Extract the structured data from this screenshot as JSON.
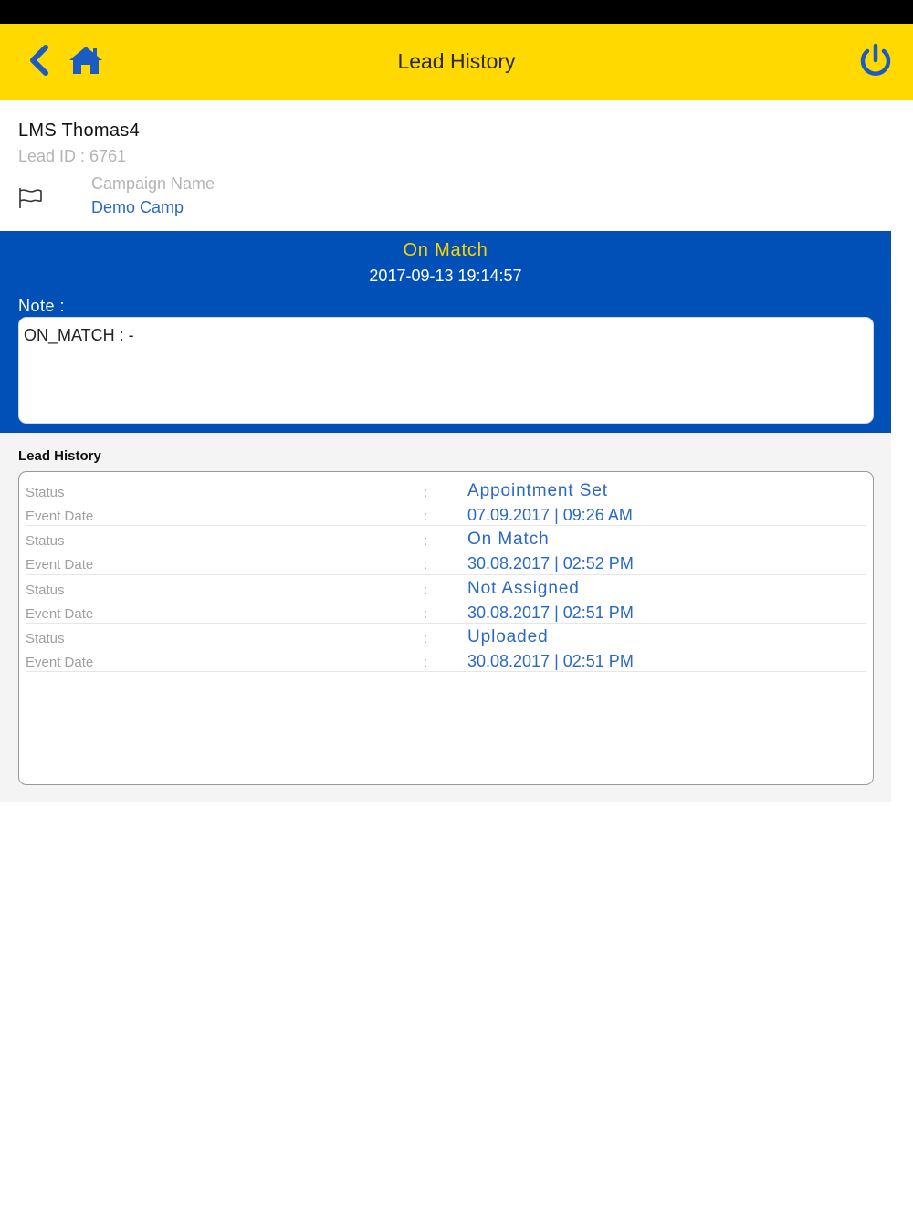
{
  "colors": {
    "nav_bar": "#FFD900",
    "accent_blue": "#0050B8",
    "link_blue": "#2a68c6",
    "status_yellow": "#FFD400"
  },
  "nav": {
    "title": "Lead History",
    "back_icon": "chevron-left-icon",
    "home_icon": "home-icon",
    "power_icon": "power-icon"
  },
  "lead": {
    "name": "LMS Thomas4",
    "lead_id": "Lead ID : 6761",
    "campaign_label": "Campaign Name",
    "campaign_value": "Demo Camp",
    "campaign_icon": "flag-icon"
  },
  "current_status": {
    "title": "On Match",
    "datetime": "2017-09-13 19:14:57",
    "note_label": "Note :",
    "note_text": "ON_MATCH : -"
  },
  "history": {
    "title": "Lead History",
    "status_label": "Status",
    "event_date_label": "Event Date",
    "separator": ":",
    "entries": [
      {
        "status": "Appointment Set",
        "event_date": "07.09.2017 | 09:26 AM"
      },
      {
        "status": "On Match",
        "event_date": "30.08.2017 | 02:52 PM"
      },
      {
        "status": "Not Assigned",
        "event_date": "30.08.2017 | 02:51 PM"
      },
      {
        "status": "Uploaded",
        "event_date": "30.08.2017 | 02:51 PM"
      }
    ]
  }
}
